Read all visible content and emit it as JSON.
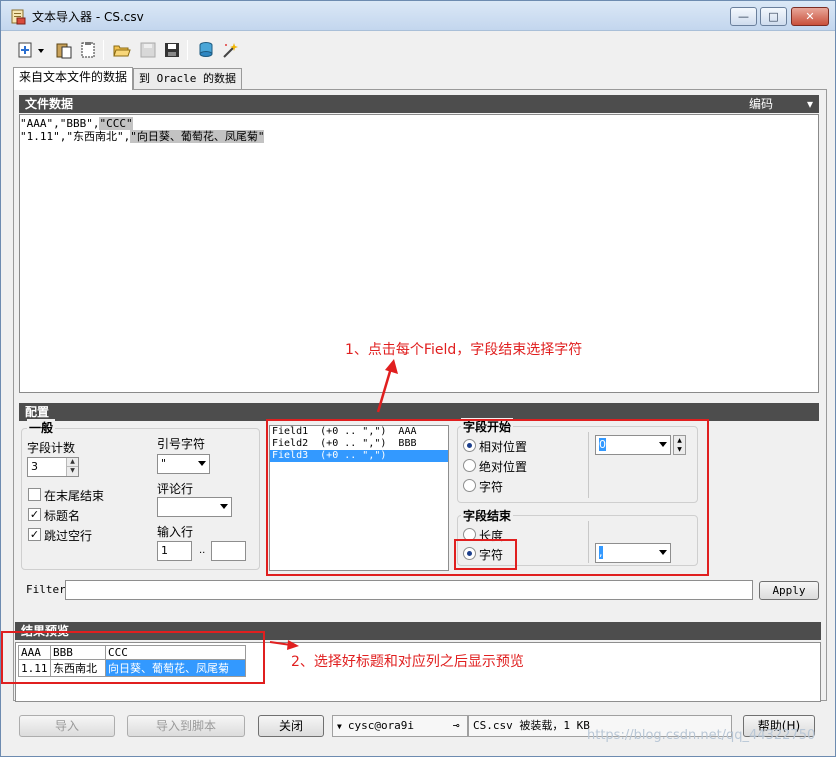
{
  "window": {
    "title": "文本导入器 - CS.csv",
    "min_label": "—",
    "max_label": "□",
    "close_label": "✕"
  },
  "toolbar": {
    "icons": [
      "open-file-icon",
      "paste-icon",
      "clipboard-icon",
      "open-folder-icon",
      "save-disabled-icon",
      "save-icon",
      "database-icon",
      "wand-icon"
    ]
  },
  "tabs": [
    {
      "label": "来自文本文件的数据",
      "active": true
    },
    {
      "label": "到 Oracle 的数据",
      "active": false
    }
  ],
  "file_data": {
    "header": "文件数据",
    "encoding_label": "编码",
    "lines": [
      {
        "plain": "\"AAA\",\"BBB\",",
        "highlight": "\"CCC\""
      },
      {
        "plain": "\"1.11\",\"东西南北\",",
        "highlight": "\"向日葵、葡萄花、凤尾菊\""
      }
    ]
  },
  "config": {
    "header": "配置",
    "general": {
      "title": "一般",
      "field_count_label": "字段计数",
      "field_count_value": "3",
      "end_at_tail_label": "在末尾结束",
      "end_at_tail_checked": false,
      "header_names_label": "标题名",
      "header_names_checked": true,
      "skip_empty_label": "跳过空行",
      "skip_empty_checked": true,
      "quote_char_label": "引号字符",
      "quote_char_value": "\"",
      "comment_row_label": "评论行",
      "comment_row_value": "",
      "input_row_label": "输入行",
      "input_row_from": "1",
      "input_row_sep": "..",
      "input_row_to": ""
    },
    "fields": [
      {
        "text": "Field1  (+0 .. \",\")  AAA",
        "selected": false
      },
      {
        "text": "Field2  (+0 .. \",\")  BBB",
        "selected": false
      },
      {
        "text": "Field3  (+0 .. \",\")",
        "selected": true
      }
    ],
    "field_start": {
      "title": "字段开始",
      "options": [
        "相对位置",
        "绝对位置",
        "字符"
      ],
      "selected_index": 0,
      "value": "0"
    },
    "field_end": {
      "title": "字段结束",
      "options": [
        "长度",
        "字符"
      ],
      "selected_index": 1,
      "value": ","
    },
    "filter_label": "Filter",
    "filter_value": "",
    "apply_label": "Apply"
  },
  "annotations": {
    "note1": "1、点击每个Field，字段结束选择字符",
    "note2": "2、选择好标题和对应列之后显示预览"
  },
  "preview": {
    "header": "结果预览",
    "columns": [
      "AAA",
      "BBB",
      "CCC"
    ],
    "rows": [
      [
        "1.11",
        "东西南北",
        "向日葵、葡萄花、凤尾菊"
      ]
    ]
  },
  "buttons": {
    "import": "导入",
    "import_script": "导入到脚本",
    "close": "关闭",
    "help": "帮助(H)"
  },
  "status": {
    "connection": "cysc@ora9i",
    "message": "CS.csv 被装载，1 KB"
  },
  "watermark": "https://blog.csdn.net/qq_44322750",
  "colors": {
    "section_header": "#4d4d4d",
    "selection": "#3399ff",
    "annotation": "#e01f1f"
  }
}
